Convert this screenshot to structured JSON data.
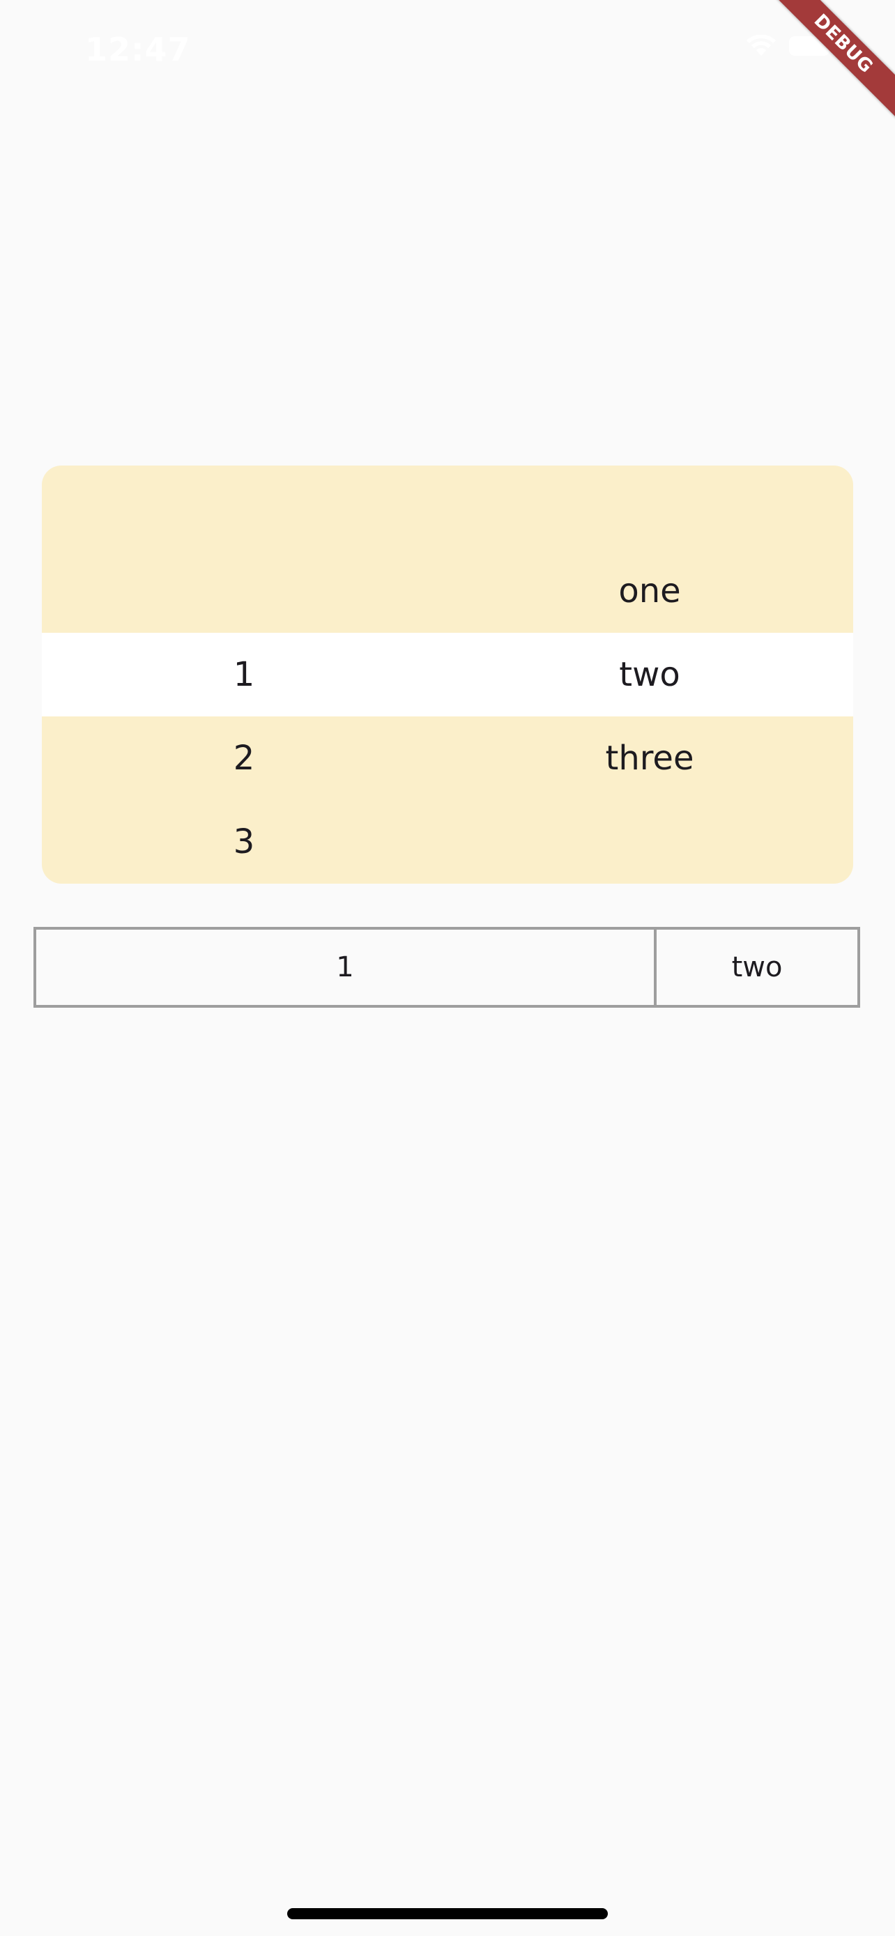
{
  "status_bar": {
    "time": "12:47",
    "icons": [
      "wifi-icon",
      "battery-icon"
    ],
    "color": "#ffffff"
  },
  "debug_banner": {
    "label": "DEBUG",
    "color": "#a33a3a"
  },
  "rounded_table": {
    "background": "#fbefca",
    "highlight_row_background": "#ffffff",
    "rows": [
      [
        "",
        "one"
      ],
      [
        "1",
        "two"
      ],
      [
        "2",
        "three"
      ],
      [
        "3",
        ""
      ]
    ]
  },
  "bordered_table": {
    "border_color": "#9e9e9e",
    "rows": [
      [
        "1",
        "two"
      ]
    ]
  }
}
